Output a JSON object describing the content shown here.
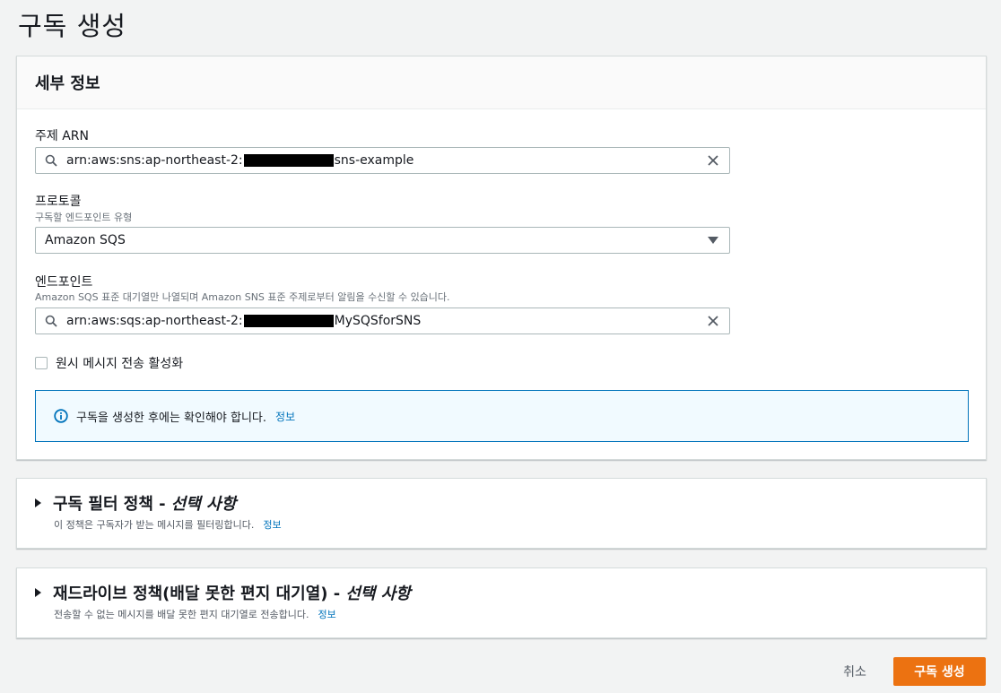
{
  "page": {
    "title": "구독 생성"
  },
  "details": {
    "header": "세부 정보",
    "topic_arn": {
      "label": "주제 ARN",
      "value_prefix": "arn:aws:sns:ap-northeast-2:",
      "value_suffix": "sns-example"
    },
    "protocol": {
      "label": "프로토콜",
      "description": "구독할 엔드포인트 유형",
      "selected": "Amazon SQS"
    },
    "endpoint": {
      "label": "엔드포인트",
      "description": "Amazon SQS 표준 대기열만 나열되며 Amazon SNS 표준 주제로부터 알림을 수신할 수 있습니다.",
      "value_prefix": "arn:aws:sqs:ap-northeast-2:",
      "value_suffix": "MySQSforSNS"
    },
    "raw_message": {
      "label": "원시 메시지 전송 활성화",
      "checked": false
    },
    "info_alert": {
      "text": "구독을 생성한 후에는 확인해야 합니다.",
      "link": "정보"
    }
  },
  "filter_policy": {
    "title": "구독 필터 정책 -",
    "optional": "선택 사항",
    "description": "이 정책은 구독자가 받는 메시지를 필터링합니다.",
    "link": "정보"
  },
  "redrive_policy": {
    "title": "재드라이브 정책(배달 못한 편지 대기열) -",
    "optional": "선택 사항",
    "description": "전송할 수 없는 메시지를 배달 못한 편지 대기열로 전송합니다.",
    "link": "정보"
  },
  "actions": {
    "cancel": "취소",
    "create": "구독 생성"
  },
  "colors": {
    "primary": "#ec7211",
    "link": "#0073bb",
    "info_bg": "#f1faff"
  }
}
